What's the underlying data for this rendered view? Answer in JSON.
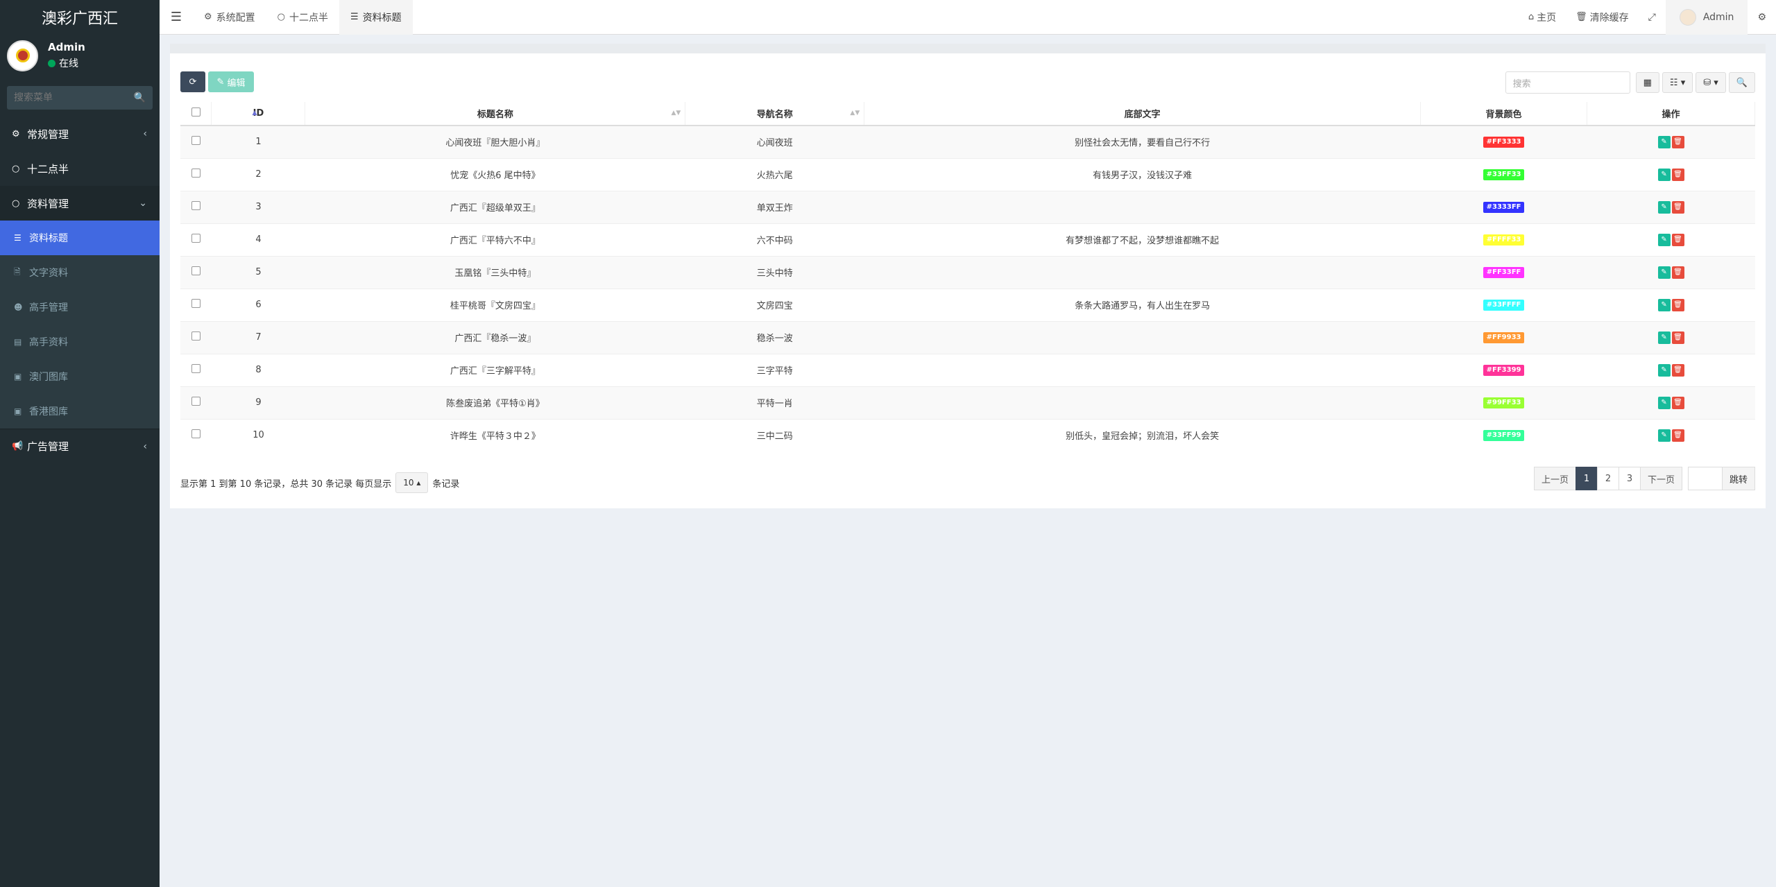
{
  "sidebar": {
    "brand": "澳彩广西汇",
    "user": {
      "name": "Admin",
      "status": "在线"
    },
    "search_placeholder": "搜索菜单",
    "menu": [
      {
        "label": "常规管理",
        "icon": "cogs-icon"
      },
      {
        "label": "十二点半",
        "icon": "circle-icon"
      },
      {
        "label": "资料管理",
        "icon": "circle-icon"
      }
    ],
    "submenu": [
      {
        "label": "资料标题",
        "icon": "list-icon"
      },
      {
        "label": "文字资料",
        "icon": "file-icon"
      },
      {
        "label": "高手管理",
        "icon": "user-icon"
      },
      {
        "label": "高手资料",
        "icon": "database-icon"
      },
      {
        "label": "澳门图库",
        "icon": "image-icon"
      },
      {
        "label": "香港图库",
        "icon": "image-icon"
      }
    ],
    "ads": {
      "label": "广告管理",
      "icon": "bullhorn-icon"
    }
  },
  "header": {
    "tabs": [
      {
        "label": "系统配置",
        "icon": "gear-icon"
      },
      {
        "label": "十二点半",
        "icon": "circle-icon"
      },
      {
        "label": "资料标题",
        "icon": "list-icon"
      }
    ],
    "home": "主页",
    "clear_cache": "清除缓存",
    "admin": "Admin"
  },
  "toolbar": {
    "edit_label": "编辑",
    "search_placeholder": "搜索"
  },
  "table": {
    "columns": [
      "ID",
      "标题名称",
      "导航名称",
      "底部文字",
      "背景颜色",
      "操作"
    ],
    "rows": [
      {
        "id": "1",
        "title": "心闻夜班『胆大胆小肖』",
        "nav": "心闻夜班",
        "footer": "别怪社会太无情，要看自己行不行",
        "color": "#FF3333"
      },
      {
        "id": "2",
        "title": "忧宠《火热6 尾中特》",
        "nav": "火热六尾",
        "footer": "有钱男子汉，没钱汉子难",
        "color": "#33FF33"
      },
      {
        "id": "3",
        "title": "广西汇『超级单双王』",
        "nav": "单双王炸",
        "footer": "",
        "color": "#3333FF"
      },
      {
        "id": "4",
        "title": "广西汇『平特六不中』",
        "nav": "六不中码",
        "footer": "有梦想谁都了不起，没梦想谁都瞧不起",
        "color": "#FFFF33"
      },
      {
        "id": "5",
        "title": "玉凰铭『三头中特』",
        "nav": "三头中特",
        "footer": "",
        "color": "#FF33FF"
      },
      {
        "id": "6",
        "title": "桂平桃哥『文房四宝』",
        "nav": "文房四宝",
        "footer": "条条大路通罗马，有人出生在罗马",
        "color": "#33FFFF"
      },
      {
        "id": "7",
        "title": "广西汇『稳杀一波』",
        "nav": "稳杀一波",
        "footer": "",
        "color": "#FF9933"
      },
      {
        "id": "8",
        "title": "广西汇『三字解平特』",
        "nav": "三字平特",
        "footer": "",
        "color": "#FF3399"
      },
      {
        "id": "9",
        "title": "陈叁废追弟《平特①肖》",
        "nav": "平特一肖",
        "footer": "",
        "color": "#99FF33"
      },
      {
        "id": "10",
        "title": "许晔生《平特３中２》",
        "nav": "三中二码",
        "footer": "别低头，皇冠会掉；别流泪，坏人会笑",
        "color": "#33FF99"
      }
    ]
  },
  "footer": {
    "info_prefix": "显示第 1 到第 10 条记录，总共 30 条记录 每页显示",
    "page_size": "10",
    "info_suffix": "条记录"
  },
  "pagination": {
    "prev": "上一页",
    "pages": [
      "1",
      "2",
      "3"
    ],
    "next": "下一页",
    "jump": "跳转"
  }
}
